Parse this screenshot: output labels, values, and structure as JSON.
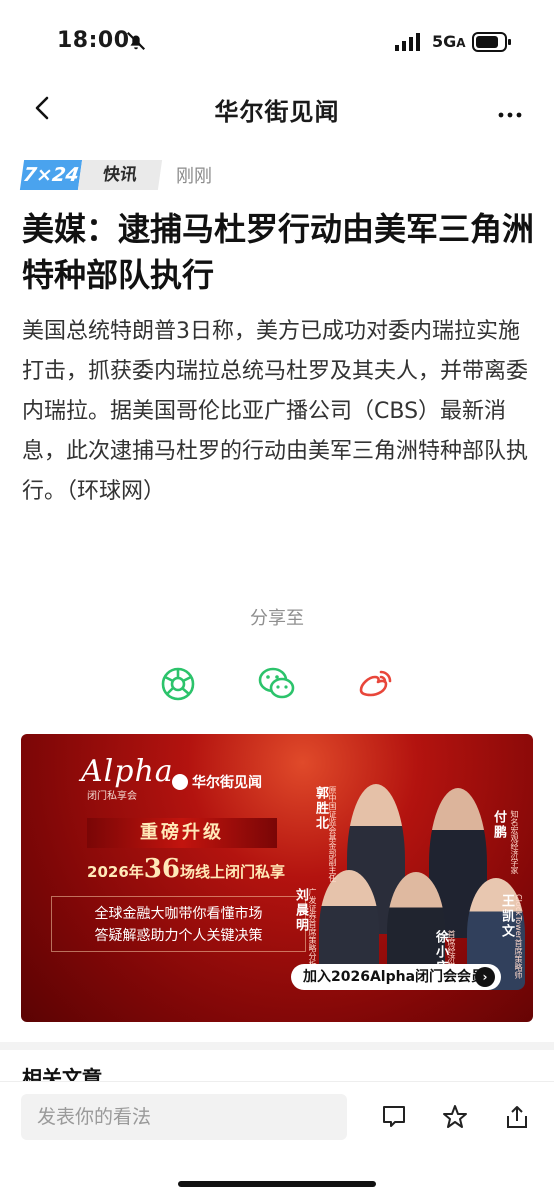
{
  "status": {
    "time": "18:00",
    "network": "5G"
  },
  "nav": {
    "title": "华尔街见闻"
  },
  "tag": {
    "badge724": "7×24",
    "badge_news": "快讯",
    "time": "刚刚"
  },
  "article": {
    "headline": "美媒：逮捕马杜罗行动由美军三角洲特种部队执行",
    "body": "美国总统特朗普3日称，美方已成功对委内瑞拉实施打击，抓获委内瑞拉总统马杜罗及其夫人，并带离委内瑞拉。据美国哥伦比亚广播公司（CBS）最新消息，此次逮捕马杜罗的行动由美军三角洲特种部队执行。（环球网）"
  },
  "share": {
    "label": "分享至"
  },
  "banner": {
    "alpha": "Alpha",
    "alpha_badge": "闭门私享会",
    "wsj": "华尔街见闻",
    "upgrade": "重磅升级",
    "sessions_prefix": "2026年",
    "sessions_number": "36",
    "sessions_suffix": "场线上闭门私享",
    "line1": "全球金融大咖带你看懂市场",
    "line2": "答疑解惑助力个人关键决策",
    "people": [
      {
        "name": "郭胜北",
        "title": "原中国证监会基金部副主任"
      },
      {
        "name": "付鹏",
        "title": "知名宏观经济学家"
      },
      {
        "name": "刘晨明",
        "title": "广发证券首席策略分析师"
      },
      {
        "name": "徐小庆",
        "title": "首席经济学家"
      },
      {
        "name": "王凯文",
        "title": "ClockTower首席策略师"
      }
    ],
    "join": "加入2026Alpha闭门会会员"
  },
  "related": {
    "title": "相关文章"
  },
  "bottom": {
    "comment_placeholder": "发表你的看法"
  }
}
